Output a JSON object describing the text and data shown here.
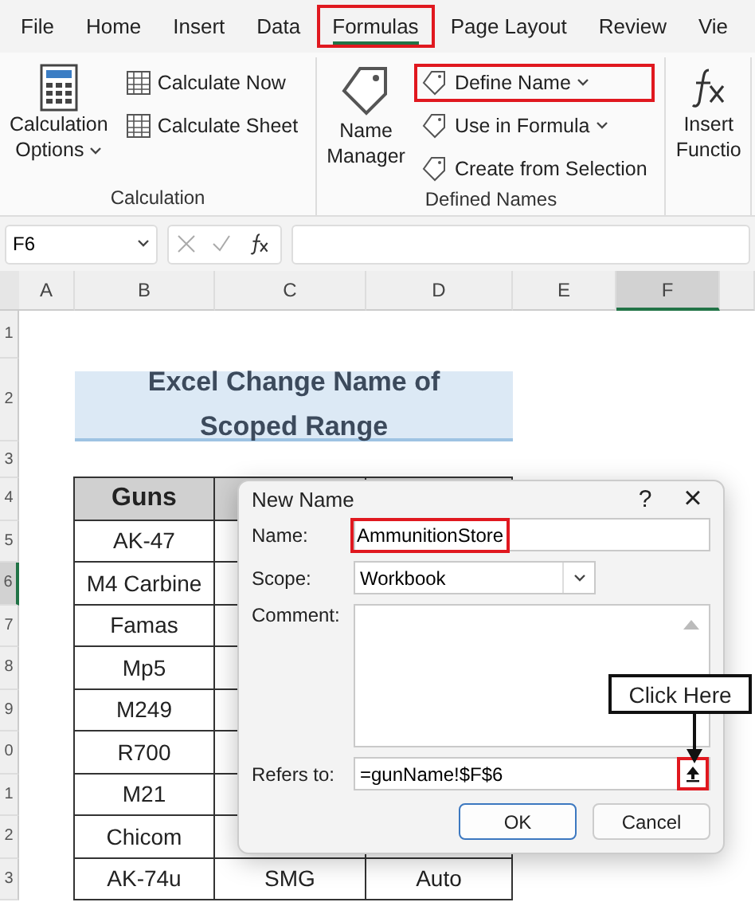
{
  "ribbon_tabs": [
    {
      "label": "File",
      "selected": false,
      "highlighted": false
    },
    {
      "label": "Home",
      "selected": false,
      "highlighted": false
    },
    {
      "label": "Insert",
      "selected": false,
      "highlighted": false
    },
    {
      "label": "Data",
      "selected": false,
      "highlighted": false
    },
    {
      "label": "Formulas",
      "selected": true,
      "highlighted": true
    },
    {
      "label": "Page Layout",
      "selected": false,
      "highlighted": false
    },
    {
      "label": "Review",
      "selected": false,
      "highlighted": false
    },
    {
      "label": "Vie",
      "selected": false,
      "highlighted": false
    }
  ],
  "ribbon_groups": [
    {
      "kind": "calculation",
      "label": "Calculation",
      "large_button": {
        "lines": [
          "Calculation",
          "Options"
        ],
        "caret": true
      },
      "buttons": [
        {
          "label": "Calculate Now",
          "caret": false,
          "highlighted": false
        },
        {
          "label": "Calculate Sheet",
          "caret": false,
          "highlighted": false
        }
      ]
    },
    {
      "kind": "names",
      "label": "Defined Names",
      "large_button": {
        "lines": [
          "Name",
          "Manager"
        ],
        "caret": false
      },
      "buttons": [
        {
          "label": "Define Name",
          "caret": true,
          "highlighted": true
        },
        {
          "label": "Use in Formula",
          "caret": true,
          "highlighted": false
        },
        {
          "label": "Create from Selection",
          "caret": false,
          "highlighted": false
        }
      ]
    },
    {
      "kind": "function",
      "large_button": {
        "lines": [
          "Insert",
          "Functio"
        ],
        "caret": false
      }
    }
  ],
  "formula_bar": {
    "name_box": "F6"
  },
  "columns": [
    {
      "label": "A",
      "selected": false
    },
    {
      "label": "B",
      "selected": false
    },
    {
      "label": "C",
      "selected": false
    },
    {
      "label": "D",
      "selected": false
    },
    {
      "label": "E",
      "selected": false
    },
    {
      "label": "F",
      "selected": true
    }
  ],
  "rows": [
    {
      "label": "1",
      "selected": false
    },
    {
      "label": "2",
      "selected": false
    },
    {
      "label": "3",
      "selected": false
    },
    {
      "label": "4",
      "selected": false
    },
    {
      "label": "5",
      "selected": false
    },
    {
      "label": "6",
      "selected": true
    },
    {
      "label": "7",
      "selected": false
    },
    {
      "label": "8",
      "selected": false
    },
    {
      "label": "9",
      "selected": false
    },
    {
      "label": "0",
      "selected": false
    },
    {
      "label": "1",
      "selected": false
    },
    {
      "label": "2",
      "selected": false
    },
    {
      "label": "3",
      "selected": false
    }
  ],
  "sheet_title": "Excel Change Name of Scoped Range",
  "table": {
    "header": "Guns",
    "rows": [
      [
        "AK-47"
      ],
      [
        "M4 Carbine"
      ],
      [
        "Famas"
      ],
      [
        "Mp5"
      ],
      [
        "M249"
      ],
      [
        "R700"
      ],
      [
        "M21"
      ],
      [
        "Chicom"
      ],
      [
        "AK-74u",
        "SMG",
        "Auto"
      ]
    ]
  },
  "dialog": {
    "title": "New Name",
    "help": "?",
    "close": "×",
    "name": {
      "label": "Name:",
      "value": "AmmunitionStore",
      "highlighted": true
    },
    "scope": {
      "label": "Scope:",
      "value": "Workbook"
    },
    "comment": {
      "label": "Comment:"
    },
    "refers_to": {
      "label": "Refers to:",
      "value": "=gunName!$F$6",
      "button_highlighted": true
    },
    "buttons": [
      {
        "label": "OK",
        "default": true
      },
      {
        "label": "Cancel",
        "default": false
      }
    ]
  },
  "callout": {
    "text": "Click Here"
  }
}
